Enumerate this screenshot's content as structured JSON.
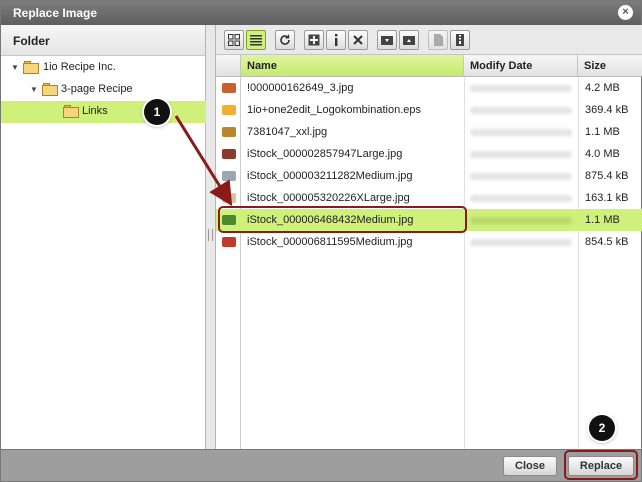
{
  "dialog": {
    "title": "Replace Image",
    "close_glyph": "×"
  },
  "folder_panel": {
    "heading": "Folder",
    "tree": [
      {
        "label": "1io Recipe Inc."
      },
      {
        "label": "3-page Recipe"
      },
      {
        "label": "Links"
      }
    ]
  },
  "toolbar": {
    "buttons": [
      {
        "icon": "thumbnail-view-icon"
      },
      {
        "icon": "list-view-icon"
      },
      {
        "icon": "refresh-icon"
      },
      {
        "icon": "add-icon"
      },
      {
        "icon": "info-icon"
      },
      {
        "icon": "delete-icon"
      },
      {
        "icon": "folder-download-icon"
      },
      {
        "icon": "folder-upload-icon"
      },
      {
        "icon": "document-icon"
      },
      {
        "icon": "zip-icon"
      }
    ]
  },
  "files": {
    "columns": {
      "name": "Name",
      "modify_date": "Modify Date",
      "size": "Size"
    },
    "rows": [
      {
        "name": "!000000162649_3.jpg",
        "size": "4.2 MB",
        "thumb": "#c9602c"
      },
      {
        "name": "1io+one2edit_Logokombination.eps",
        "size": "369.4 kB",
        "thumb": "#f0b030"
      },
      {
        "name": "7381047_xxl.jpg",
        "size": "1.1 MB",
        "thumb": "#b8862c"
      },
      {
        "name": "iStock_000002857947Large.jpg",
        "size": "4.0 MB",
        "thumb": "#8a3b2a"
      },
      {
        "name": "iStock_000003211282Medium.jpg",
        "size": "875.4 kB",
        "thumb": "#9aa7b3"
      },
      {
        "name": "iStock_000005320226XLarge.jpg",
        "size": "163.1 kB",
        "thumb": "#d8c2a4"
      },
      {
        "name": "iStock_000006468432Medium.jpg",
        "size": "1.1 MB",
        "thumb": "#4e8a2c"
      },
      {
        "name": "iStock_000006811595Medium.jpg",
        "size": "854.5 kB",
        "thumb": "#c0392b"
      }
    ]
  },
  "footer": {
    "close_label": "Close",
    "replace_label": "Replace"
  },
  "annotations": {
    "step1": "1",
    "step2": "2"
  },
  "colors": {
    "accent": "#cff07b",
    "callout": "#8b1a1a"
  }
}
